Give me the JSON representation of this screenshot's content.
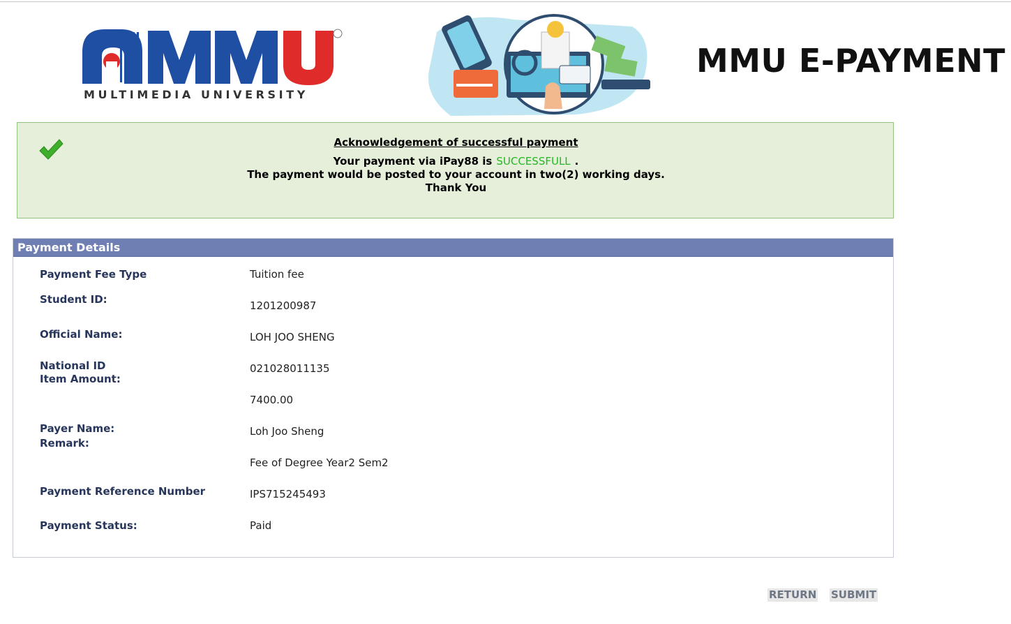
{
  "header": {
    "logo_word": "MMU",
    "logo_subtitle": "MULTIMEDIA UNIVERSITY",
    "logo_registered": "®",
    "title": "MMU E-PAYMENT"
  },
  "notice": {
    "heading": "Acknowledgement of successful payment",
    "line1_prefix": "Your payment via iPay88 is",
    "status": "SUCCESSFULL",
    "line1_suffix": ".",
    "line2": "The payment would be posted to your account in two(2) working days.",
    "line3": "Thank You"
  },
  "details": {
    "title": "Payment Details",
    "labels": {
      "fee_type": "Payment Fee Type",
      "student_id": "Student ID:",
      "official_name": "Official Name:",
      "national_id": "National ID",
      "item_amount": "Item Amount:",
      "payer_name": "Payer Name:",
      "remark": "Remark:",
      "reference": "Payment Reference Number",
      "status": "Payment Status:"
    },
    "values": {
      "fee_type": "Tuition fee",
      "student_id": "1201200987",
      "official_name": "LOH JOO SHENG",
      "national_id": "021028011135",
      "item_amount": "7400.00",
      "payer_name": "Loh Joo Sheng",
      "remark": "Fee of Degree Year2 Sem2",
      "reference": "IPS715245493",
      "status": "Paid"
    }
  },
  "actions": {
    "return_label": "RETURN",
    "submit_label": "SUBMIT"
  },
  "colors": {
    "logo_blue": "#1f4fa3",
    "logo_red": "#e02b2b",
    "notice_bg": "#e5efd9",
    "notice_border": "#8ec47b",
    "success_green": "#25b825",
    "panel_header": "#6f7fb3",
    "label_navy": "#27365a"
  }
}
